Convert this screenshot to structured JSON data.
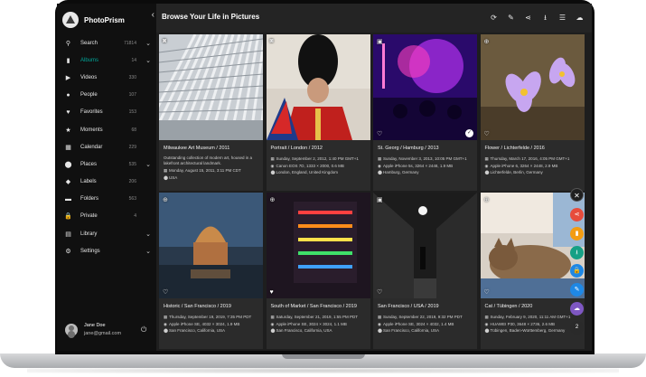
{
  "app": {
    "name": "PhotoPrism"
  },
  "header": {
    "title": "Browse Your Life in Pictures"
  },
  "sidebar": {
    "items": [
      {
        "label": "Search",
        "count": "71814",
        "icon": "search-icon",
        "active": false,
        "chevron": true
      },
      {
        "label": "Albums",
        "count": "14",
        "icon": "bookmark-icon",
        "active": true,
        "chevron": true
      },
      {
        "label": "Videos",
        "count": "330",
        "icon": "play-icon",
        "active": false,
        "chevron": false
      },
      {
        "label": "People",
        "count": "107",
        "icon": "person-icon",
        "active": false,
        "chevron": false
      },
      {
        "label": "Favorites",
        "count": "153",
        "icon": "heart-icon",
        "active": false,
        "chevron": false
      },
      {
        "label": "Moments",
        "count": "68",
        "icon": "star-icon",
        "active": false,
        "chevron": false
      },
      {
        "label": "Calendar",
        "count": "229",
        "icon": "calendar-icon",
        "active": false,
        "chevron": false
      },
      {
        "label": "Places",
        "count": "535",
        "icon": "pin-icon",
        "active": false,
        "chevron": true
      },
      {
        "label": "Labels",
        "count": "206",
        "icon": "label-icon",
        "active": false,
        "chevron": false
      },
      {
        "label": "Folders",
        "count": "563",
        "icon": "folder-icon",
        "active": false,
        "chevron": false
      },
      {
        "label": "Private",
        "count": "4",
        "icon": "lock-icon",
        "active": false,
        "chevron": false
      },
      {
        "label": "Library",
        "count": "",
        "icon": "library-icon",
        "active": false,
        "chevron": true
      },
      {
        "label": "Settings",
        "count": "",
        "icon": "gear-icon",
        "active": false,
        "chevron": true
      }
    ]
  },
  "user": {
    "name": "Jane Doe",
    "email": "jane@gmail.com"
  },
  "toolbar": [
    "refresh-icon",
    "edit-icon",
    "share-icon",
    "download-icon",
    "view-list-icon",
    "cloud-upload-icon"
  ],
  "cards": [
    {
      "title": "Milwaukee Art Museum / 2011",
      "desc": "Outstanding collection of modern art, housed in a lakefront architectural landmark.",
      "lines": [
        "Monday, August 15, 2011, 3:11 PM CDT",
        "USA"
      ],
      "line_icons": [
        "calendar",
        "pin"
      ],
      "scene": "museum"
    },
    {
      "title": "Portrait / London / 2012",
      "desc": "",
      "lines": [
        "Sunday, September 2, 2012, 1:40 PM GMT+1",
        "Canon EOS 7D, 1333 × 2000, 0.6 MB",
        "London, England, United Kingdom"
      ],
      "line_icons": [
        "calendar",
        "camera",
        "pin"
      ],
      "scene": "guard"
    },
    {
      "title": "St. Georg / Hamburg / 2013",
      "desc": "",
      "lines": [
        "Sunday, November 3, 2013, 10:05 PM GMT+1",
        "Apple iPhone 5s, 3264 × 2448, 1.9 MB",
        "Hamburg, Germany"
      ],
      "line_icons": [
        "calendar",
        "camera",
        "pin"
      ],
      "scene": "club"
    },
    {
      "title": "Flower / Lichterfelde / 2016",
      "desc": "",
      "lines": [
        "Thursday, March 17, 2016, 4:05 PM GMT+1",
        "Apple iPhone 6, 3264 × 2448, 2.9 MB",
        "Lichterfelde, Berlin, Germany"
      ],
      "line_icons": [
        "calendar",
        "camera",
        "pin"
      ],
      "scene": "flower"
    },
    {
      "title": "Historic / San Francisco / 2019",
      "desc": "",
      "lines": [
        "Thursday, September 19, 2019, 7:35 PM PDT",
        "Apple iPhone SE, 4032 × 3024, 1.9 MB",
        "San Francisco, California, USA"
      ],
      "line_icons": [
        "calendar",
        "camera",
        "pin"
      ],
      "scene": "palace"
    },
    {
      "title": "South of Market / San Francisco / 2019",
      "desc": "",
      "lines": [
        "Saturday, September 21, 2019, 1:55 PM PDT",
        "Apple iPhone SE, 3024 × 3024, 1.1 MB",
        "San Francisco, California, USA"
      ],
      "line_icons": [
        "calendar",
        "camera",
        "pin"
      ],
      "scene": "neon"
    },
    {
      "title": "San Francisco / USA / 2019",
      "desc": "",
      "lines": [
        "Sunday, September 22, 2019, 9:32 PM PDT",
        "Apple iPhone SE, 3024 × 4032, 1.4 MB",
        "San Francisco, California, USA"
      ],
      "line_icons": [
        "calendar",
        "camera",
        "pin"
      ],
      "scene": "street"
    },
    {
      "title": "Cat / Tübingen / 2020",
      "desc": "",
      "lines": [
        "Sunday, February 9, 2020, 11:11 AM GMT+1",
        "HUAWEI P30, 3648 × 2736, 2.6 MB",
        "Tübingen, Baden-Württemberg, Germany"
      ],
      "line_icons": [
        "calendar",
        "camera",
        "pin"
      ],
      "scene": "cat"
    }
  ],
  "fab": {
    "count": "2",
    "colors": [
      "#e74c3c",
      "#f39c12",
      "#16a085",
      "#1e88e5",
      "#1e88e5",
      "#7e57c2"
    ]
  }
}
